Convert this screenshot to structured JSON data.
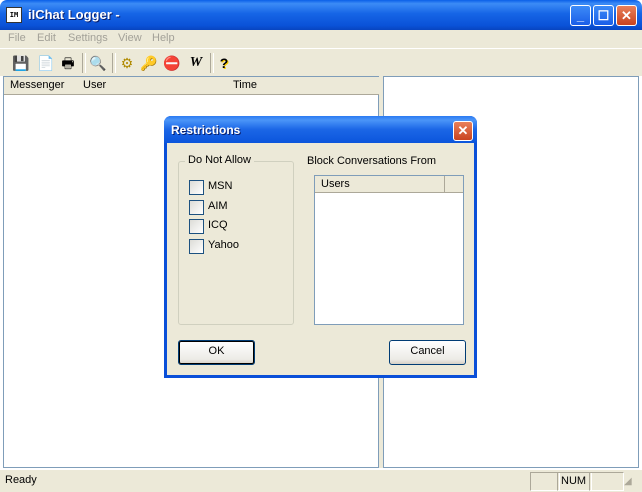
{
  "window": {
    "title": "iIChat Logger -",
    "icon_text": "IM"
  },
  "menu": [
    "File",
    "Edit",
    "Settings",
    "View",
    "Help"
  ],
  "toolbar": {
    "icons": [
      "save-icon",
      "copy-icon",
      "print-icon",
      "find-icon",
      "settings-icon",
      "key-icon",
      "block-icon",
      "website-icon",
      "help-icon"
    ],
    "glyphs": [
      "💾",
      "📄",
      "🖶",
      "🔍",
      "⚙",
      "🔑",
      "⛔",
      "W",
      "?"
    ]
  },
  "log_table": {
    "columns": [
      "Messenger",
      "User",
      "Time"
    ]
  },
  "status": {
    "text": "Ready",
    "num": "NUM"
  },
  "dialog": {
    "title": "Restrictions",
    "group_label": "Do Not Allow",
    "messengers": [
      {
        "label": "MSN",
        "checked": false
      },
      {
        "label": "AIM",
        "checked": false
      },
      {
        "label": "ICQ",
        "checked": false
      },
      {
        "label": "Yahoo",
        "checked": false
      }
    ],
    "block_label": "Block Conversations From",
    "users_column": "Users",
    "ok_label": "OK",
    "cancel_label": "Cancel"
  }
}
